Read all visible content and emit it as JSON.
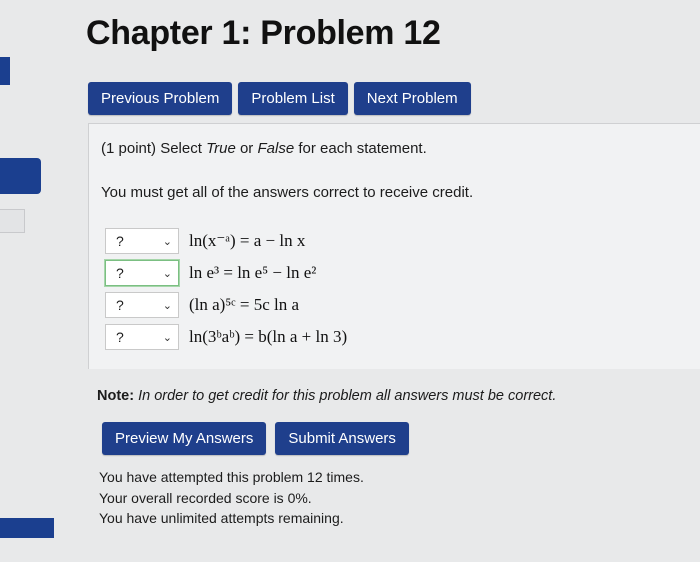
{
  "page": {
    "title": "Chapter 1: Problem 12"
  },
  "nav": {
    "previous": "Previous Problem",
    "list": "Problem List",
    "next": "Next Problem"
  },
  "problem": {
    "points": "(1 point)",
    "instruction_pre": "Select ",
    "true_word": "True",
    "or_word": " or ",
    "false_word": "False",
    "instruction_post": " for each statement.",
    "requirement": "You must get all of the answers correct to receive credit.",
    "statements": [
      {
        "selected": "?",
        "expression": "ln(x⁻ᵃ) = a − ln x"
      },
      {
        "selected": "?",
        "expression": "ln e³ = ln e⁵ − ln e²"
      },
      {
        "selected": "?",
        "expression": "(ln a)⁵ᶜ = 5c ln a"
      },
      {
        "selected": "?",
        "expression": "ln(3ᵇaᵇ) = b(ln a + ln 3)"
      }
    ]
  },
  "note": {
    "label": "Note:",
    "text": " In order to get credit for this problem all answers must be correct."
  },
  "actions": {
    "preview": "Preview My Answers",
    "submit": "Submit Answers"
  },
  "status": {
    "attempts": "You have attempted this problem 12 times.",
    "score": "Your overall recorded score is 0%.",
    "remaining": "You have unlimited attempts remaining."
  },
  "colors": {
    "accent": "#1f3f8c",
    "focus": "#7bbf82"
  }
}
